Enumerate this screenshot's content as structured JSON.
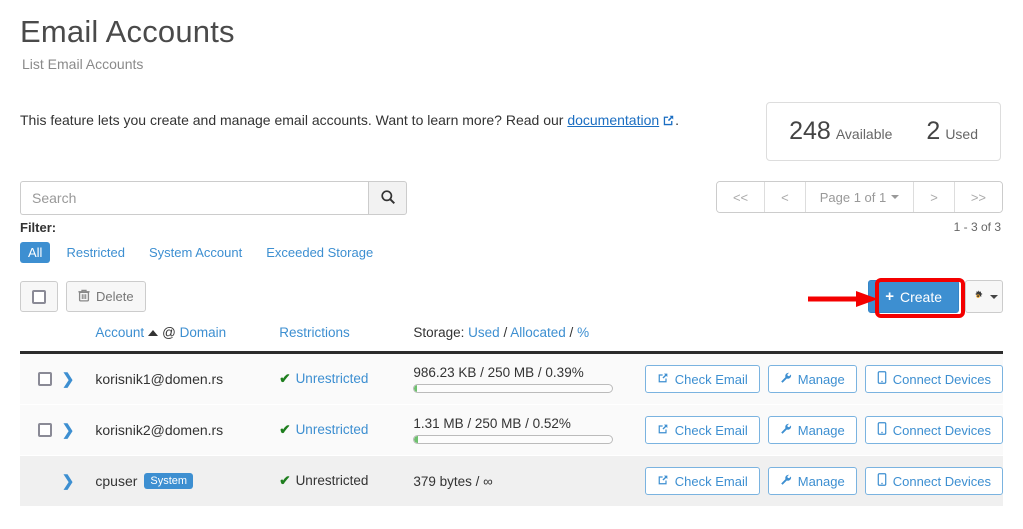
{
  "header": {
    "title": "Email Accounts",
    "subtitle": "List Email Accounts",
    "intro_before": "This feature lets you create and manage email accounts. Want to learn more? Read our ",
    "intro_link": "documentation",
    "intro_after": "."
  },
  "stats": {
    "available_value": "248",
    "available_label": "Available",
    "used_value": "2",
    "used_label": "Used"
  },
  "search": {
    "placeholder": "Search",
    "icon": "search-icon"
  },
  "pagination": {
    "first": "<<",
    "prev": "<",
    "page_label": "Page 1 of 1",
    "next": ">",
    "last": ">>",
    "range": "1 - 3 of 3"
  },
  "filter": {
    "label": "Filter:",
    "tabs": [
      {
        "label": "All",
        "active": true
      },
      {
        "label": "Restricted",
        "active": false
      },
      {
        "label": "System Account",
        "active": false
      },
      {
        "label": "Exceeded Storage",
        "active": false
      }
    ]
  },
  "actions": {
    "select_all": "",
    "delete_label": "Delete",
    "create_label": "Create",
    "create_plus": "+",
    "gear_icon": "gear-icon"
  },
  "table": {
    "headers": {
      "account": "Account",
      "at": "@",
      "domain": "Domain",
      "restrictions": "Restrictions",
      "storage_prefix": "Storage:",
      "storage_used": "Used",
      "sep1": "/",
      "storage_allocated": "Allocated",
      "sep2": "/",
      "storage_percent": "%"
    },
    "rows": [
      {
        "account": "korisnik1@domen.rs",
        "has_checkbox": true,
        "badge": null,
        "restriction": "Unrestricted",
        "restriction_is_link": true,
        "storage": "986.23 KB / 250 MB / 0.39%",
        "progress_percent": 0.39,
        "has_progress": true,
        "system": false,
        "buttons": [
          "Check Email",
          "Manage",
          "Connect Devices"
        ]
      },
      {
        "account": "korisnik2@domen.rs",
        "has_checkbox": true,
        "badge": null,
        "restriction": "Unrestricted",
        "restriction_is_link": true,
        "storage": "1.31 MB / 250 MB / 0.52%",
        "progress_percent": 0.52,
        "has_progress": true,
        "system": false,
        "buttons": [
          "Check Email",
          "Manage",
          "Connect Devices"
        ]
      },
      {
        "account": "cpuser",
        "has_checkbox": false,
        "badge": "System",
        "restriction": "Unrestricted",
        "restriction_is_link": false,
        "storage": "379 bytes / ∞",
        "progress_percent": 0,
        "has_progress": false,
        "system": true,
        "buttons": [
          "Check Email",
          "Manage",
          "Connect Devices"
        ]
      }
    ],
    "button_icons": {
      "check_email": "external-link-icon",
      "manage": "wrench-icon",
      "connect_devices": "mobile-device-icon"
    }
  },
  "annotations": {
    "highlight_target": "create-button",
    "arrow_color": "#f40000",
    "box_color": "#f40000"
  },
  "colors": {
    "accent": "#3d8fd1",
    "link": "#1b6ec2",
    "success": "#1e7e1e",
    "annotation": "#f40000"
  }
}
